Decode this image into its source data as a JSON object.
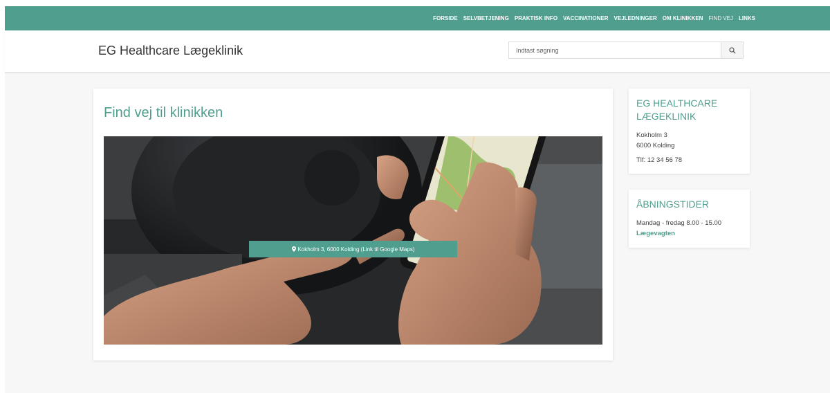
{
  "nav": {
    "items": [
      {
        "label": "FORSIDE"
      },
      {
        "label": "SELVBETJENING"
      },
      {
        "label": "PRAKTISK INFO"
      },
      {
        "label": "VACCINATIONER"
      },
      {
        "label": "VEJLEDNINGER"
      },
      {
        "label": "OM KLINIKKEN"
      },
      {
        "label": "FIND VEJ"
      },
      {
        "label": "LINKS"
      }
    ],
    "active": "FIND VEJ"
  },
  "header": {
    "site_title": "EG Healthcare Lægeklinik",
    "search_placeholder": "Indtast søgning",
    "search_icon": "search-icon"
  },
  "main": {
    "title": "Find vej til klinikken",
    "hero_image": "hands-holding-phone-with-map",
    "map_link_icon": "map-marker-icon",
    "map_link_label": "Kokholm 3, 6000 Kolding (Link til Google Maps)"
  },
  "sidebar": {
    "clinic": {
      "title": "EG HEALTHCARE LÆGEKLINIK",
      "address_line1": "Kokholm 3",
      "address_line2": "6000 Kolding",
      "phone": "Tlf: 12 34 56 78"
    },
    "hours": {
      "title": "ÅBNINGSTIDER",
      "weekdays": "Mandag - fredag 8.00 - 15.00",
      "link": "Lægevagten"
    }
  },
  "colors": {
    "accent": "#4f9e8e",
    "background": "#f7f7f7",
    "card": "#ffffff",
    "text": "#333333"
  }
}
